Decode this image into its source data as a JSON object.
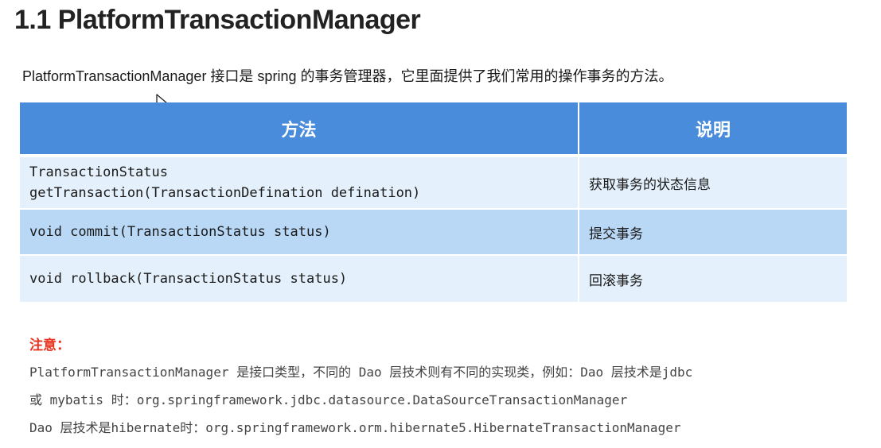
{
  "heading": "1.1 PlatformTransactionManager",
  "intro": "PlatformTransactionManager 接口是 spring 的事务管理器，它里面提供了我们常用的操作事务的方法。",
  "table": {
    "headers": [
      "方法",
      "说明"
    ],
    "rows": [
      {
        "method": "TransactionStatus\ngetTransaction(TransactionDefination defination)",
        "desc": "获取事务的状态信息"
      },
      {
        "method": "void commit(TransactionStatus status)",
        "desc": "提交事务"
      },
      {
        "method": "void rollback(TransactionStatus status)",
        "desc": "回滚事务"
      }
    ]
  },
  "note": {
    "title": "注意：",
    "lines": [
      "PlatformTransactionManager 是接口类型，不同的 Dao 层技术则有不同的实现类，例如：Dao 层技术是jdbc",
      "或 mybatis 时：org.springframework.jdbc.datasource.DataSourceTransactionManager",
      "Dao 层技术是hibernate时：org.springframework.orm.hibernate5.HibernateTransactionManager"
    ]
  },
  "colors": {
    "header_bg": "#4a8cdc",
    "row_light": "#e4f0fb",
    "row_dark": "#b9d8f6",
    "note_title": "#e8321e"
  },
  "icons": [
    "mouse-cursor-icon"
  ]
}
